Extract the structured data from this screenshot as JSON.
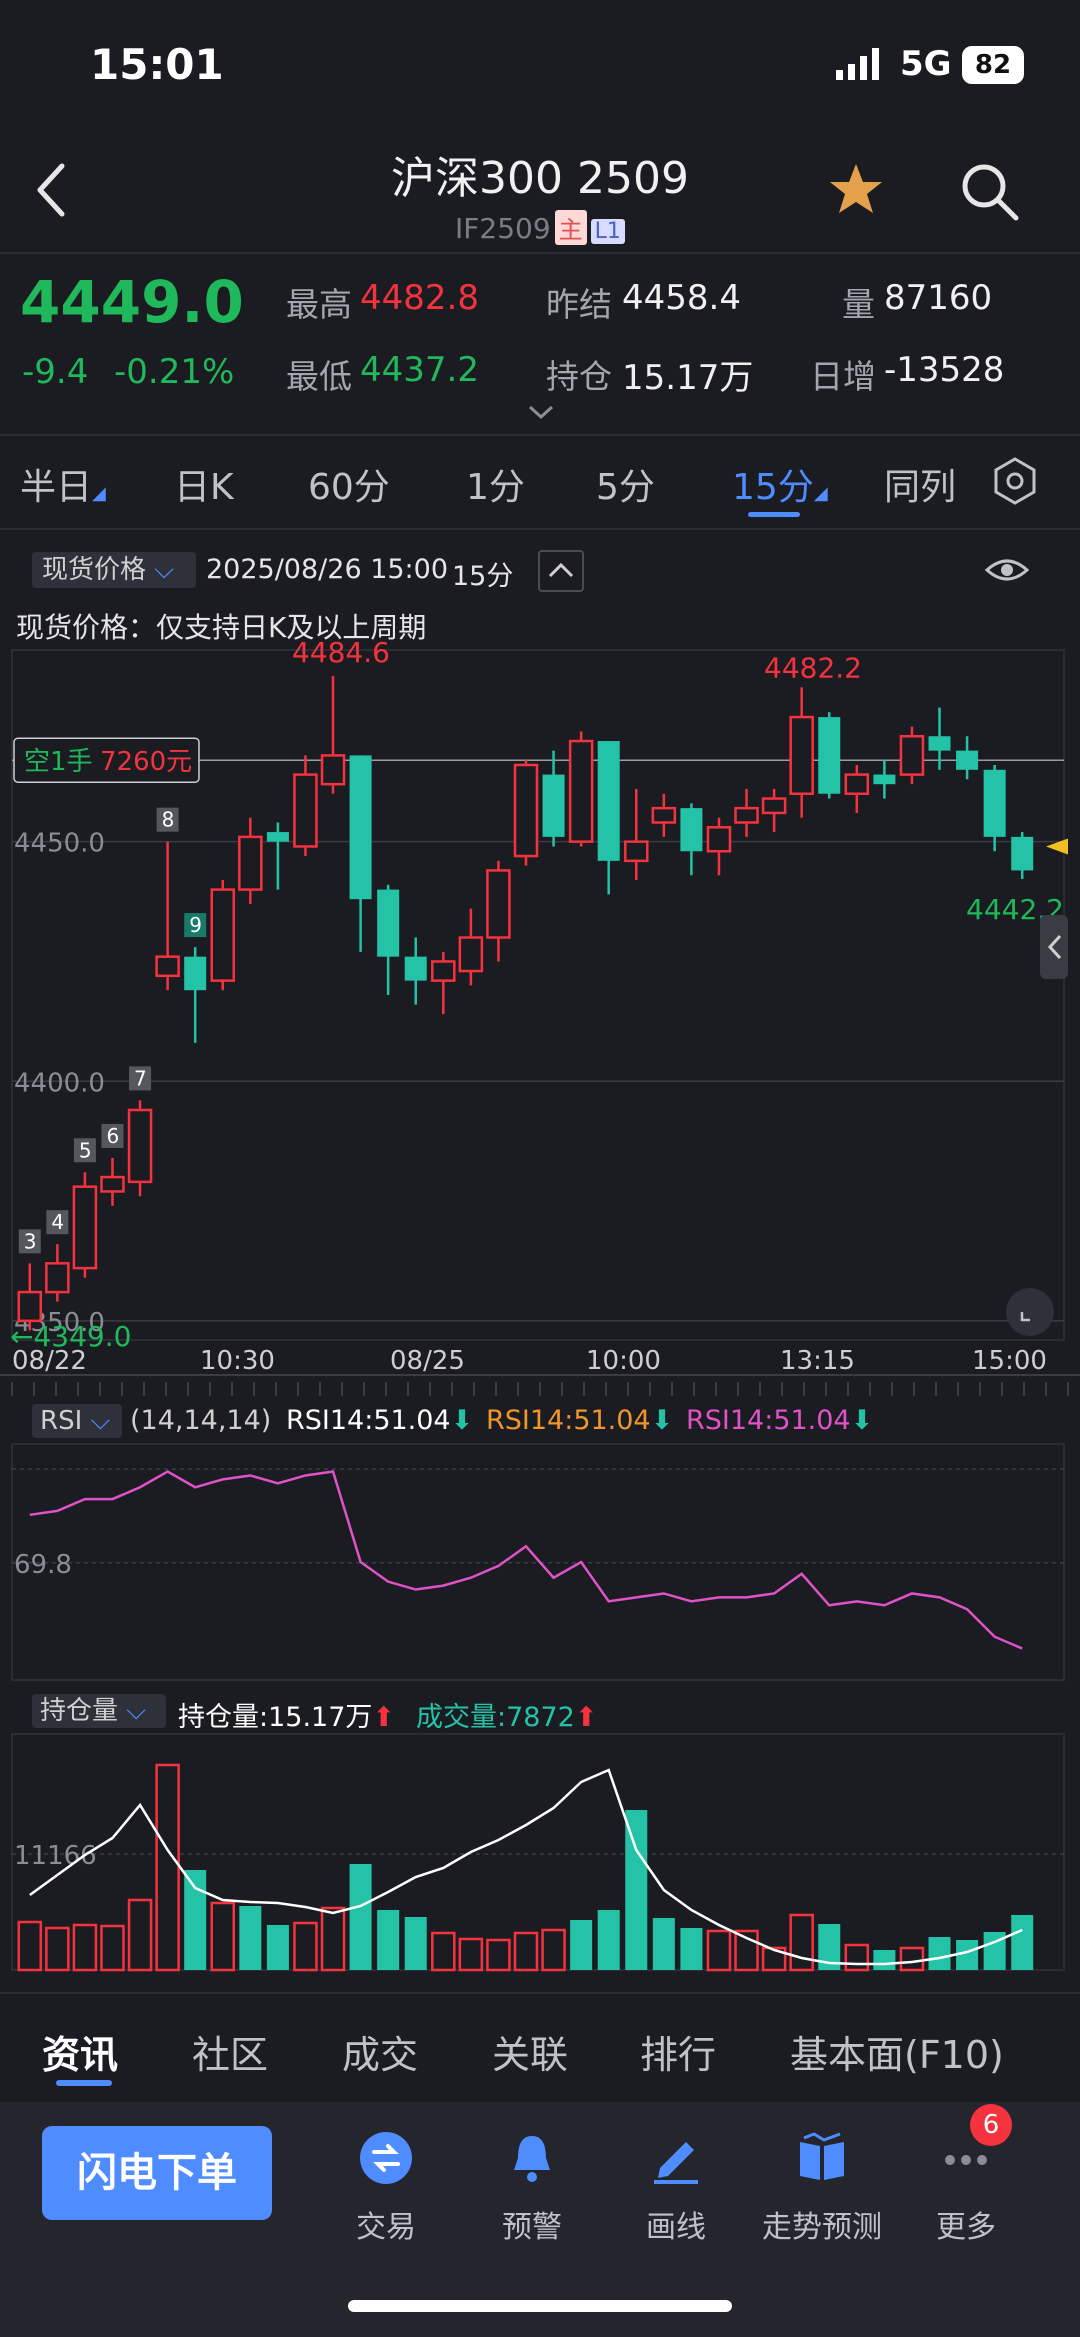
{
  "status": {
    "time": "15:01",
    "network": "5G",
    "battery": "82"
  },
  "header": {
    "title": "沪深300 2509",
    "code": "IF2509",
    "tag_main": "主",
    "tag_l1": "L1"
  },
  "quote": {
    "price": "4449.0",
    "change": "-9.4",
    "change_pct": "-0.21%",
    "high_label": "最高",
    "high": "4482.8",
    "low_label": "最低",
    "low": "4437.2",
    "prev_label": "昨结",
    "prev": "4458.4",
    "oi_label": "持仓",
    "oi": "15.17万",
    "vol_label": "量",
    "vol": "87160",
    "daily_inc_label": "日增",
    "daily_inc": "-13528"
  },
  "tabs": [
    {
      "label": "半日",
      "arrow": true
    },
    {
      "label": "日K"
    },
    {
      "label": "60分"
    },
    {
      "label": "1分"
    },
    {
      "label": "5分"
    },
    {
      "label": "15分",
      "arrow": true,
      "active": true
    },
    {
      "label": "同列"
    }
  ],
  "chart_toolbar": {
    "chip": "现货价格",
    "datetime": "2025/08/26 15:00",
    "period": "15分",
    "note": "现货价格：仅支持日K及以上周期"
  },
  "kline": {
    "max_label": "4484.6",
    "max2_label": "4482.2",
    "last_label": "4442.2",
    "low_label": "←4349.0",
    "position_tag": "空1手",
    "position_value": "7260元",
    "y_ticks": [
      "4450.0",
      "4400.0",
      "4350.0"
    ],
    "x_ticks": [
      "08/22",
      "10:30",
      "08/25",
      "10:00",
      "13:15",
      "15:00"
    ],
    "markers": [
      "3",
      "4",
      "5",
      "6",
      "7",
      "8",
      "9"
    ]
  },
  "rsi": {
    "chip": "RSI",
    "params": "(14,14,14)",
    "rsi1": "RSI14:51.04",
    "rsi2": "RSI14:51.04",
    "rsi3": "RSI14:51.04",
    "level": "69.8"
  },
  "oi_panel": {
    "chip": "持仓量",
    "oi_text": "持仓量:15.17万",
    "vol_text": "成交量:7872",
    "level": "11166"
  },
  "bottom_tabs": [
    "资讯",
    "社区",
    "成交",
    "关联",
    "排行",
    "基本面(F10)"
  ],
  "nav": {
    "flash": "闪电下单",
    "items": [
      "交易",
      "预警",
      "画线",
      "走势预测",
      "更多"
    ],
    "badge": "6"
  },
  "colors": {
    "up": "#f5333f",
    "down": "#24c3a8",
    "accent": "#4f8cff"
  },
  "chart_data": {
    "type": "candlestick",
    "candles": [
      {
        "o": 4350,
        "c": 4356,
        "h": 4362,
        "l": 4348
      },
      {
        "o": 4356,
        "c": 4362,
        "h": 4366,
        "l": 4354
      },
      {
        "o": 4361,
        "c": 4378,
        "h": 4381,
        "l": 4359
      },
      {
        "o": 4377,
        "c": 4380,
        "h": 4384,
        "l": 4374
      },
      {
        "o": 4379,
        "c": 4394,
        "h": 4396,
        "l": 4376
      },
      {
        "o": 4422,
        "c": 4426,
        "h": 4450,
        "l": 4419
      },
      {
        "o": 4426,
        "c": 4419,
        "h": 4428,
        "l": 4408
      },
      {
        "o": 4421,
        "c": 4440,
        "h": 4442,
        "l": 4419
      },
      {
        "o": 4440,
        "c": 4451,
        "h": 4455,
        "l": 4437
      },
      {
        "o": 4452,
        "c": 4450,
        "h": 4454,
        "l": 4440
      },
      {
        "o": 4449,
        "c": 4464,
        "h": 4468,
        "l": 4447
      },
      {
        "o": 4462,
        "c": 4468,
        "h": 4484.6,
        "l": 4460
      },
      {
        "o": 4468,
        "c": 4438,
        "h": 4468,
        "l": 4427
      },
      {
        "o": 4440,
        "c": 4426,
        "h": 4441,
        "l": 4418
      },
      {
        "o": 4426,
        "c": 4421,
        "h": 4430,
        "l": 4416
      },
      {
        "o": 4421,
        "c": 4425,
        "h": 4427,
        "l": 4414
      },
      {
        "o": 4423,
        "c": 4430,
        "h": 4436,
        "l": 4420
      },
      {
        "o": 4430,
        "c": 4444,
        "h": 4446,
        "l": 4425
      },
      {
        "o": 4447,
        "c": 4466,
        "h": 4467,
        "l": 4445
      },
      {
        "o": 4464,
        "c": 4451,
        "h": 4469,
        "l": 4449
      },
      {
        "o": 4450,
        "c": 4471,
        "h": 4473,
        "l": 4449
      },
      {
        "o": 4471,
        "c": 4446,
        "h": 4471,
        "l": 4439
      },
      {
        "o": 4446,
        "c": 4450,
        "h": 4461,
        "l": 4442
      },
      {
        "o": 4454,
        "c": 4457,
        "h": 4460,
        "l": 4451
      },
      {
        "o": 4457,
        "c": 4448,
        "h": 4458,
        "l": 4443
      },
      {
        "o": 4448,
        "c": 4453,
        "h": 4455,
        "l": 4443
      },
      {
        "o": 4454,
        "c": 4457,
        "h": 4461,
        "l": 4451
      },
      {
        "o": 4456,
        "c": 4459,
        "h": 4461,
        "l": 4452
      },
      {
        "o": 4460,
        "c": 4476,
        "h": 4482.2,
        "l": 4455
      },
      {
        "o": 4476,
        "c": 4460,
        "h": 4477,
        "l": 4459
      },
      {
        "o": 4460,
        "c": 4464,
        "h": 4466,
        "l": 4456
      },
      {
        "o": 4464,
        "c": 4462,
        "h": 4467,
        "l": 4459
      },
      {
        "o": 4464,
        "c": 4472,
        "h": 4474,
        "l": 4462
      },
      {
        "o": 4472,
        "c": 4469,
        "h": 4478,
        "l": 4465
      },
      {
        "o": 4469,
        "c": 4465,
        "h": 4472,
        "l": 4463
      },
      {
        "o": 4465,
        "c": 4451,
        "h": 4466,
        "l": 4448
      },
      {
        "o": 4451,
        "c": 4444,
        "h": 4452,
        "l": 4442.2
      }
    ],
    "ylim": [
      4346,
      4490
    ],
    "rsi": [
      82,
      83,
      86,
      86,
      89,
      93,
      89,
      91,
      92,
      90,
      92,
      93,
      70,
      65,
      63,
      64,
      66,
      69,
      74,
      66,
      70,
      60,
      61,
      62,
      60,
      61,
      61,
      62,
      67,
      59,
      60,
      59,
      62,
      61,
      58,
      51,
      48
    ],
    "oi_bars": [
      {
        "v": 48,
        "up": true
      },
      {
        "v": 42,
        "up": true
      },
      {
        "v": 45,
        "up": true
      },
      {
        "v": 44,
        "up": true
      },
      {
        "v": 70,
        "up": true
      },
      {
        "v": 205,
        "up": true
      },
      {
        "v": 100,
        "up": false
      },
      {
        "v": 67,
        "up": true
      },
      {
        "v": 64,
        "up": false
      },
      {
        "v": 45,
        "up": false
      },
      {
        "v": 47,
        "up": true
      },
      {
        "v": 62,
        "up": true
      },
      {
        "v": 106,
        "up": false
      },
      {
        "v": 60,
        "up": false
      },
      {
        "v": 53,
        "up": false
      },
      {
        "v": 37,
        "up": true
      },
      {
        "v": 31,
        "up": true
      },
      {
        "v": 30,
        "up": true
      },
      {
        "v": 37,
        "up": true
      },
      {
        "v": 40,
        "up": true
      },
      {
        "v": 50,
        "up": false
      },
      {
        "v": 60,
        "up": false
      },
      {
        "v": 160,
        "up": false
      },
      {
        "v": 52,
        "up": false
      },
      {
        "v": 42,
        "up": false
      },
      {
        "v": 39,
        "up": true
      },
      {
        "v": 39,
        "up": true
      },
      {
        "v": 22,
        "up": true
      },
      {
        "v": 55,
        "up": true
      },
      {
        "v": 46,
        "up": false
      },
      {
        "v": 25,
        "up": true
      },
      {
        "v": 20,
        "up": false
      },
      {
        "v": 22,
        "up": true
      },
      {
        "v": 33,
        "up": false
      },
      {
        "v": 30,
        "up": false
      },
      {
        "v": 38,
        "up": false
      },
      {
        "v": 55,
        "up": false
      }
    ],
    "oi_line": [
      75,
      95,
      115,
      132,
      165,
      120,
      82,
      70,
      68,
      67,
      63,
      57,
      64,
      78,
      93,
      102,
      118,
      130,
      145,
      162,
      188,
      200,
      120,
      80,
      60,
      45,
      32,
      20,
      12,
      7,
      6,
      6,
      8,
      12,
      18,
      28,
      40
    ]
  }
}
